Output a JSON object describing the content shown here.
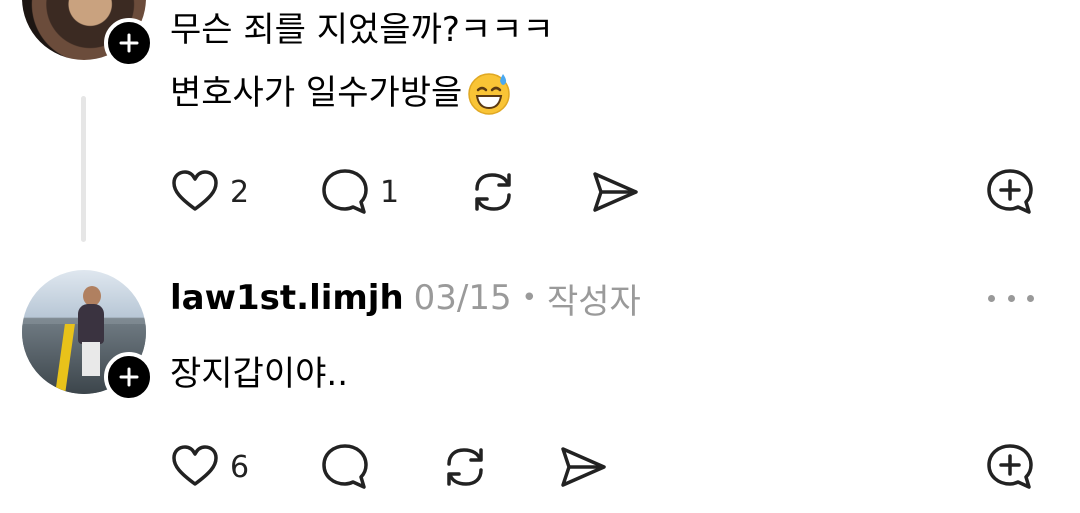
{
  "post_top": {
    "lines": [
      "무슨 죄를 지었을까?ㅋㅋㅋ",
      "변호사가 일수가방을"
    ],
    "emoji": "grinning-sweat-emoji",
    "actions": {
      "likes": "2",
      "comments": "1"
    }
  },
  "reply": {
    "username": "law1st.limjh",
    "date": "03/15",
    "separator": "•",
    "role": "작성자",
    "text": "장지갑이야..",
    "actions": {
      "likes": "6"
    }
  },
  "colors": {
    "text": "#000000",
    "muted": "#9a9a9a",
    "line": "#e6e6e6"
  }
}
